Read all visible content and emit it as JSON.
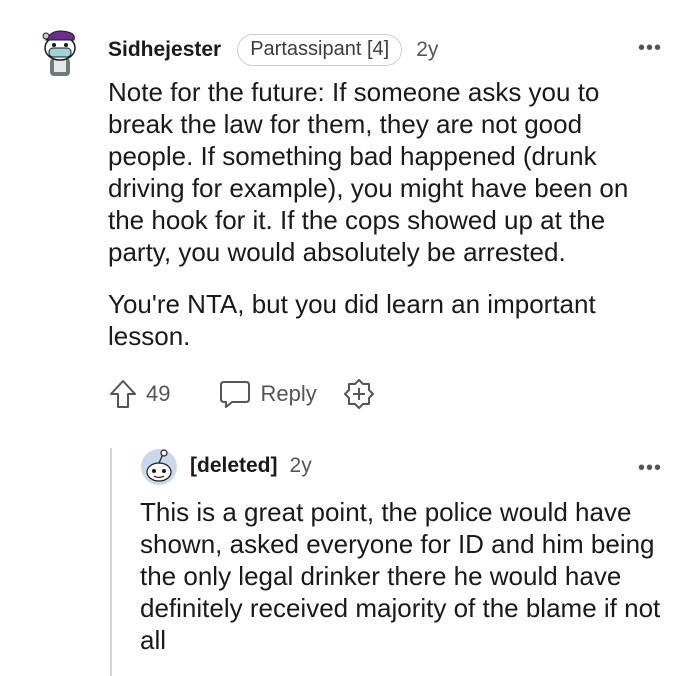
{
  "comment": {
    "username": "Sidhejester",
    "flair": "Partassipant [4]",
    "age": "2y",
    "more": "•••",
    "paragraphs": [
      "Note for the future: If someone asks you to break the law for them, they are not good people. If something bad happened (drunk driving for example), you might have been on the hook for it. If the cops showed up at the party, you would absolutely be arrested.",
      "You're NTA, but you did learn an important lesson."
    ],
    "votes": "49",
    "reply_label": "Reply"
  },
  "reply": {
    "username": "[deleted]",
    "age": "2y",
    "more": "•••",
    "body": "This is a great point, the police would have shown, asked everyone for ID and him being the only legal drinker there he would have definitely received majority of the blame if not all"
  },
  "icons": {
    "upvote": "upvote-arrow-icon",
    "reply": "speech-bubble-icon",
    "award": "add-award-icon"
  },
  "colors": {
    "text": "#1a1a1b",
    "muted": "#555555",
    "thread": "#d6d6d6"
  }
}
